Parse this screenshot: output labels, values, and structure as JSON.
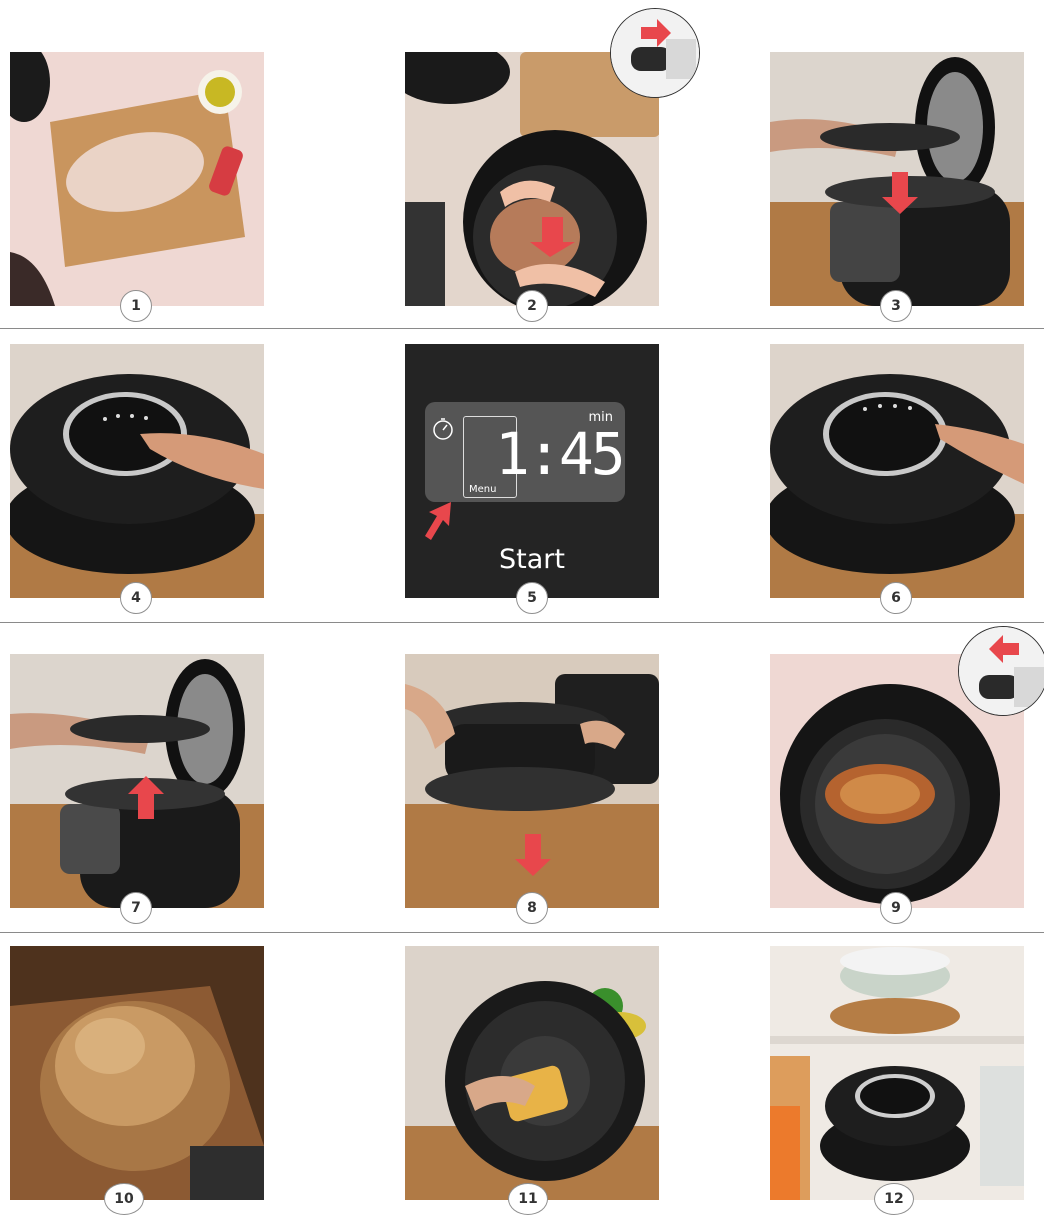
{
  "steps": [
    {
      "number": "1",
      "scene": "raw-chicken-on-board"
    },
    {
      "number": "2",
      "scene": "place-chicken-in-pot"
    },
    {
      "number": "3",
      "scene": "place-lid-on-cooker"
    },
    {
      "number": "4",
      "scene": "press-control-panel"
    },
    {
      "number": "5",
      "scene": "lcd-display"
    },
    {
      "number": "6",
      "scene": "press-start-button"
    },
    {
      "number": "7",
      "scene": "lift-lid-from-cooker"
    },
    {
      "number": "8",
      "scene": "remove-lid"
    },
    {
      "number": "9",
      "scene": "cooked-chicken-in-pot"
    },
    {
      "number": "10",
      "scene": "roasted-chicken-on-board"
    },
    {
      "number": "11",
      "scene": "clean-lid-with-sponge"
    },
    {
      "number": "12",
      "scene": "stored-cooker-on-shelf"
    }
  ],
  "lcd": {
    "time": "1:45",
    "unit": "min",
    "menu_label": "Menu",
    "start_label": "Start"
  },
  "colors": {
    "arrow": "#e8474c",
    "lcd_background": "#242424",
    "lcd_screen": "#555555"
  }
}
